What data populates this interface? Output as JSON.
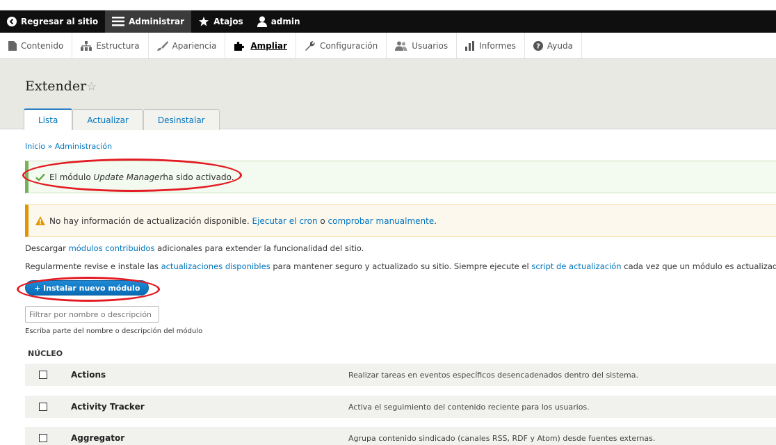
{
  "toolbar": {
    "back": "Regresar al sitio",
    "manage": "Administrar",
    "shortcuts": "Atajos",
    "user": "admin"
  },
  "tray": {
    "items": [
      "Contenido",
      "Estructura",
      "Apariencia",
      "Ampliar",
      "Configuración",
      "Usuarios",
      "Informes",
      "Ayuda"
    ]
  },
  "page": {
    "title": "Extender",
    "tabs": [
      "Lista",
      "Actualizar",
      "Desinstalar"
    ]
  },
  "breadcrumb": {
    "home": "Inicio",
    "sep": " » ",
    "admin": "Administración"
  },
  "status_message": {
    "prefix": "El módulo ",
    "module": "Update Manager",
    "suffix": " ha sido activado."
  },
  "warning_message": {
    "text": "No hay información de actualización disponible. ",
    "link1": "Ejecutar el cron",
    "mid": " o ",
    "link2": "comprobar manualmente",
    "end": "."
  },
  "para1": {
    "a": "Descargar ",
    "link": "módulos contribuidos",
    "b": " adicionales para extender la funcionalidad del sitio."
  },
  "para2": {
    "a": "Regularmente revise e instale las ",
    "link1": "actualizaciones disponibles",
    "b": " para mantener seguro y actualizado su sitio. Siempre ejecute el ",
    "link2": "script de actualización",
    "c": " cada vez que un módulo es actualizado."
  },
  "install_button": "+ Instalar nuevo módulo",
  "filter": {
    "placeholder": "Filtrar por nombre o descripción",
    "description": "Escriba parte del nombre o descripción del módulo"
  },
  "section": "NÚCLEO",
  "modules": [
    {
      "name": "Actions",
      "description": "Realizar tareas en eventos específicos desencadenados dentro del sistema."
    },
    {
      "name": "Activity Tracker",
      "description": "Activa el seguimiento del contenido reciente para los usuarios."
    },
    {
      "name": "Aggregator",
      "description": "Agrupa contenido sindicado (canales RSS, RDF y Atom) desde fuentes externas."
    }
  ],
  "colors": {
    "toolbar_bg": "#0f0f0f",
    "link": "#0074bd",
    "status_border": "#77b259",
    "warning_border": "#e09600",
    "annotation": "#e31b23"
  }
}
